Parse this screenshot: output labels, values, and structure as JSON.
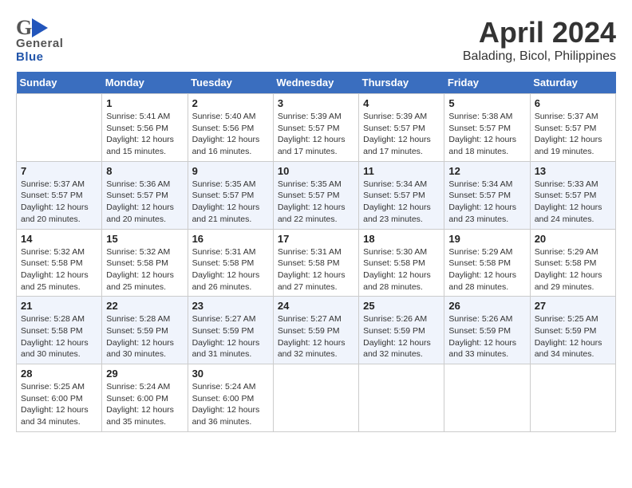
{
  "header": {
    "logo_general": "General",
    "logo_blue": "Blue",
    "title": "April 2024",
    "subtitle": "Balading, Bicol, Philippines"
  },
  "calendar": {
    "days_of_week": [
      "Sunday",
      "Monday",
      "Tuesday",
      "Wednesday",
      "Thursday",
      "Friday",
      "Saturday"
    ],
    "weeks": [
      [
        {
          "day": "",
          "info": ""
        },
        {
          "day": "1",
          "info": "Sunrise: 5:41 AM\nSunset: 5:56 PM\nDaylight: 12 hours\nand 15 minutes."
        },
        {
          "day": "2",
          "info": "Sunrise: 5:40 AM\nSunset: 5:56 PM\nDaylight: 12 hours\nand 16 minutes."
        },
        {
          "day": "3",
          "info": "Sunrise: 5:39 AM\nSunset: 5:57 PM\nDaylight: 12 hours\nand 17 minutes."
        },
        {
          "day": "4",
          "info": "Sunrise: 5:39 AM\nSunset: 5:57 PM\nDaylight: 12 hours\nand 17 minutes."
        },
        {
          "day": "5",
          "info": "Sunrise: 5:38 AM\nSunset: 5:57 PM\nDaylight: 12 hours\nand 18 minutes."
        },
        {
          "day": "6",
          "info": "Sunrise: 5:37 AM\nSunset: 5:57 PM\nDaylight: 12 hours\nand 19 minutes."
        }
      ],
      [
        {
          "day": "7",
          "info": "Sunrise: 5:37 AM\nSunset: 5:57 PM\nDaylight: 12 hours\nand 20 minutes."
        },
        {
          "day": "8",
          "info": "Sunrise: 5:36 AM\nSunset: 5:57 PM\nDaylight: 12 hours\nand 20 minutes."
        },
        {
          "day": "9",
          "info": "Sunrise: 5:35 AM\nSunset: 5:57 PM\nDaylight: 12 hours\nand 21 minutes."
        },
        {
          "day": "10",
          "info": "Sunrise: 5:35 AM\nSunset: 5:57 PM\nDaylight: 12 hours\nand 22 minutes."
        },
        {
          "day": "11",
          "info": "Sunrise: 5:34 AM\nSunset: 5:57 PM\nDaylight: 12 hours\nand 23 minutes."
        },
        {
          "day": "12",
          "info": "Sunrise: 5:34 AM\nSunset: 5:57 PM\nDaylight: 12 hours\nand 23 minutes."
        },
        {
          "day": "13",
          "info": "Sunrise: 5:33 AM\nSunset: 5:57 PM\nDaylight: 12 hours\nand 24 minutes."
        }
      ],
      [
        {
          "day": "14",
          "info": "Sunrise: 5:32 AM\nSunset: 5:58 PM\nDaylight: 12 hours\nand 25 minutes."
        },
        {
          "day": "15",
          "info": "Sunrise: 5:32 AM\nSunset: 5:58 PM\nDaylight: 12 hours\nand 25 minutes."
        },
        {
          "day": "16",
          "info": "Sunrise: 5:31 AM\nSunset: 5:58 PM\nDaylight: 12 hours\nand 26 minutes."
        },
        {
          "day": "17",
          "info": "Sunrise: 5:31 AM\nSunset: 5:58 PM\nDaylight: 12 hours\nand 27 minutes."
        },
        {
          "day": "18",
          "info": "Sunrise: 5:30 AM\nSunset: 5:58 PM\nDaylight: 12 hours\nand 28 minutes."
        },
        {
          "day": "19",
          "info": "Sunrise: 5:29 AM\nSunset: 5:58 PM\nDaylight: 12 hours\nand 28 minutes."
        },
        {
          "day": "20",
          "info": "Sunrise: 5:29 AM\nSunset: 5:58 PM\nDaylight: 12 hours\nand 29 minutes."
        }
      ],
      [
        {
          "day": "21",
          "info": "Sunrise: 5:28 AM\nSunset: 5:58 PM\nDaylight: 12 hours\nand 30 minutes."
        },
        {
          "day": "22",
          "info": "Sunrise: 5:28 AM\nSunset: 5:59 PM\nDaylight: 12 hours\nand 30 minutes."
        },
        {
          "day": "23",
          "info": "Sunrise: 5:27 AM\nSunset: 5:59 PM\nDaylight: 12 hours\nand 31 minutes."
        },
        {
          "day": "24",
          "info": "Sunrise: 5:27 AM\nSunset: 5:59 PM\nDaylight: 12 hours\nand 32 minutes."
        },
        {
          "day": "25",
          "info": "Sunrise: 5:26 AM\nSunset: 5:59 PM\nDaylight: 12 hours\nand 32 minutes."
        },
        {
          "day": "26",
          "info": "Sunrise: 5:26 AM\nSunset: 5:59 PM\nDaylight: 12 hours\nand 33 minutes."
        },
        {
          "day": "27",
          "info": "Sunrise: 5:25 AM\nSunset: 5:59 PM\nDaylight: 12 hours\nand 34 minutes."
        }
      ],
      [
        {
          "day": "28",
          "info": "Sunrise: 5:25 AM\nSunset: 6:00 PM\nDaylight: 12 hours\nand 34 minutes."
        },
        {
          "day": "29",
          "info": "Sunrise: 5:24 AM\nSunset: 6:00 PM\nDaylight: 12 hours\nand 35 minutes."
        },
        {
          "day": "30",
          "info": "Sunrise: 5:24 AM\nSunset: 6:00 PM\nDaylight: 12 hours\nand 36 minutes."
        },
        {
          "day": "",
          "info": ""
        },
        {
          "day": "",
          "info": ""
        },
        {
          "day": "",
          "info": ""
        },
        {
          "day": "",
          "info": ""
        }
      ]
    ]
  }
}
